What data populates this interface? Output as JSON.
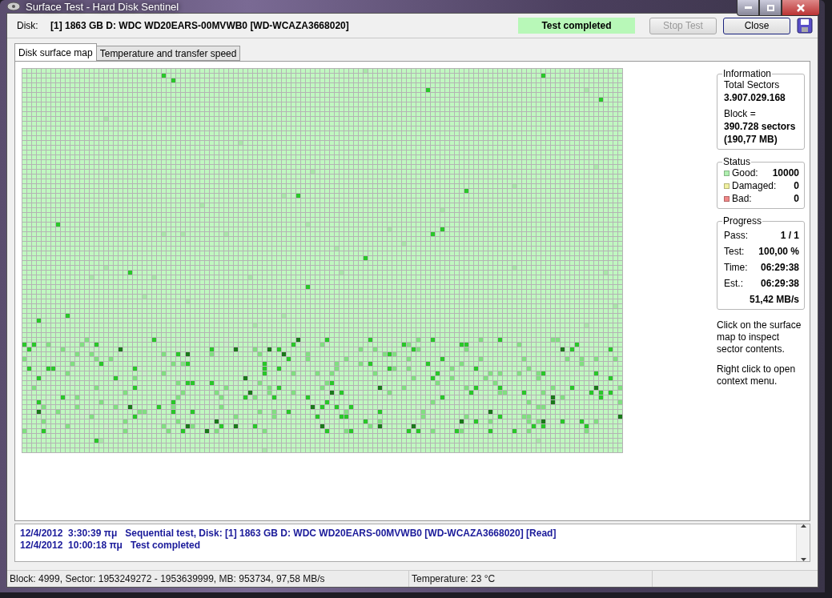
{
  "window": {
    "title": "Surface Test - Hard Disk Sentinel"
  },
  "disk": {
    "label": "Disk:",
    "value": "[1] 1863 GB D: WDC WD20EARS-00MVWB0 [WD-WCAZA3668020]"
  },
  "status_text": "Test completed",
  "buttons": [
    {
      "label": "Stop Test",
      "disabled": true
    },
    {
      "label": "Close",
      "disabled": false
    }
  ],
  "tabs": [
    {
      "label": "Disk surface map",
      "selected": true
    },
    {
      "label": "Temperature and transfer speed",
      "selected": false
    }
  ],
  "information": {
    "title": "Information",
    "lines": [
      {
        "text": "Total Sectors",
        "bold": false
      },
      {
        "text": "3.907.029.168",
        "bold": true
      },
      {
        "text": "Block =",
        "bold": false
      },
      {
        "text": "390.728 sectors",
        "bold": true
      },
      {
        "text": "(190,77 MB)",
        "bold": true
      }
    ]
  },
  "status": {
    "title": "Status",
    "items": [
      {
        "label": "Good:",
        "value": "10000",
        "color": "#b0f0b0"
      },
      {
        "label": "Damaged:",
        "value": "0",
        "color": "#f0f0a0"
      },
      {
        "label": "Bad:",
        "value": "0",
        "color": "#f08888"
      }
    ]
  },
  "progress": {
    "title": "Progress",
    "rows": [
      {
        "label": "Pass:",
        "value": "1 / 1"
      },
      {
        "label": "Test:",
        "value": "100,00 %"
      },
      {
        "label": "Time:",
        "value": "06:29:38"
      },
      {
        "label": "Est.:",
        "value": "06:29:38"
      },
      {
        "value": "51,42 MB/s"
      }
    ]
  },
  "hints": [
    "Click on the surface map to inspect sector contents.",
    "Right click to open context menu."
  ],
  "log": [
    {
      "time": "12/4/2012  3:30:39 πμ",
      "message": "Sequential test, Disk: [1] 1863 GB D: WDC WD20EARS-00MVWB0 [WD-WCAZA3668020] [Read]"
    },
    {
      "time": "12/4/2012  10:00:18 πμ",
      "message": "Test completed"
    }
  ],
  "status_bar": [
    "Block: 4999, Sector: 1953249272 - 1953639999, MB: 953734, 97,58 MB/s",
    "Temperature: 23  °C"
  ]
}
